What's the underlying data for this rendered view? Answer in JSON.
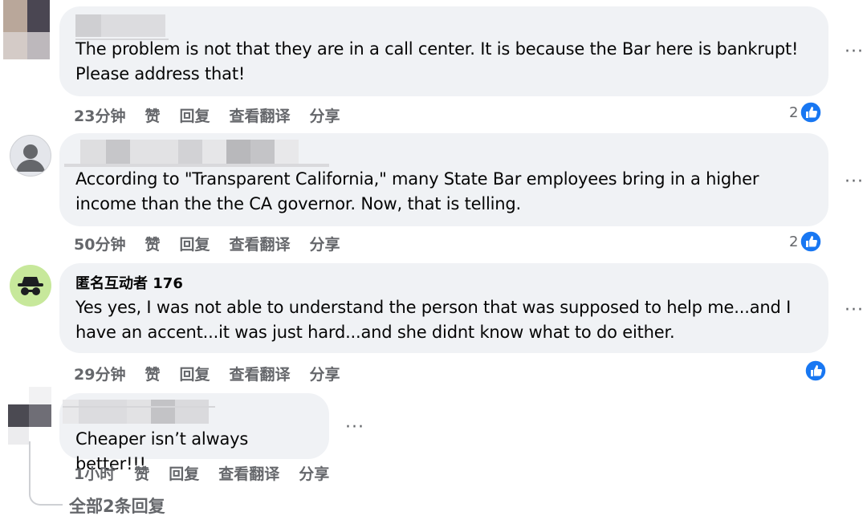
{
  "comments": [
    {
      "name": "",
      "text": "The problem is not that they are in a call center. It is because the Bar here is bankrupt!\nPlease address that!",
      "time": "23分钟",
      "reactions": "2"
    },
    {
      "name": "",
      "text": "According to \"Transparent California,\" many State Bar employees bring in a higher\nincome than the the CA governor. Now, that is telling.",
      "time": "50分钟",
      "reactions": "2"
    },
    {
      "name": "匿名互动者 176",
      "text": "Yes yes, I was not able to understand the person that was supposed to help me...and I\nhave an accent...it was just hard...and she didnt know what to do either.",
      "time": "29分钟",
      "reactions": ""
    },
    {
      "name": "",
      "text": "Cheaper isn’t always better!!!",
      "time": "1小时",
      "reactions": ""
    }
  ],
  "actions": {
    "like": "赞",
    "reply": "回复",
    "translate": "查看翻译",
    "share": "分享"
  },
  "more_icon": "···",
  "view_replies": "全部2条回复",
  "colors": {
    "bubble": "#f0f2f5",
    "like_blue": "#1877f2",
    "secondary_text": "#65676b",
    "anon_avatar": "#c7e89b"
  },
  "icons": {
    "like": "thumbs-up-icon",
    "more": "more-dots-icon",
    "anonymous": "anonymous-spy-icon",
    "avatar": "default-avatar-icon"
  }
}
